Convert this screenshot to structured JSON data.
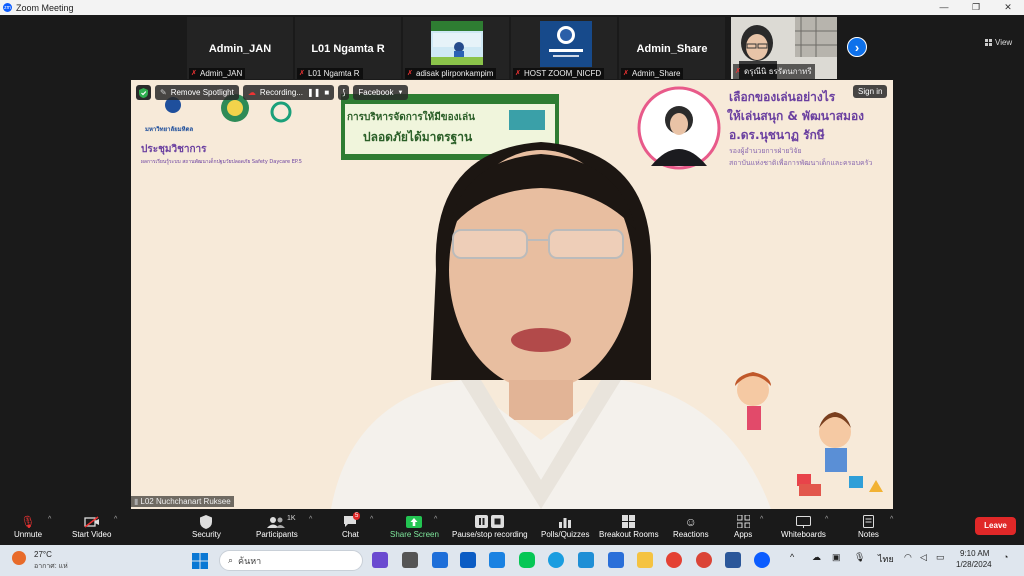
{
  "window": {
    "title": "Zoom Meeting",
    "icon": "zoom-logo-icon",
    "controls": [
      "minimize-icon",
      "maximize-icon",
      "close-icon"
    ]
  },
  "gallery": {
    "tiles": [
      {
        "name": "Admin_JAN",
        "label": "Admin_JAN",
        "video": false
      },
      {
        "name": "L01 Ngamta R",
        "label": "L01 Ngamta R",
        "video": false
      },
      {
        "name": "",
        "label": "adisak plirponkampim",
        "video": true
      },
      {
        "name": "",
        "label": "HOST ZOOM_NICFD",
        "video": true
      },
      {
        "name": "Admin_Share",
        "label": "Admin_Share",
        "video": false
      },
      {
        "name": "",
        "label": "ดรุณีนิ ธรรัตนกาทรี",
        "video": true
      }
    ],
    "next_icon": "chevron-right-icon",
    "view_label": "View"
  },
  "main_video": {
    "speaker_label": "L02 Nuchchanart Ruksee",
    "top_controls": {
      "remove_spotlight": "Remove Spotlight",
      "recording": "Recording...",
      "facebook": "Facebook"
    },
    "sign_in": "Sign in",
    "slide": {
      "university_name": "มหาวิทยาลัยมหิดล",
      "conference_label": "ประชุมวิชาการ",
      "subtitle": "ผลการเรียนรู้ระบบ สถานพัฒนาเด็กปฐมวัยปลอดภัย Safety Daycare EP.5",
      "banner_line1": "การบริหารจัดการให้มีของเล่น",
      "banner_line2": "ปลอดภัยได้มาตรฐาน",
      "headline_line1": "เลือกของเล่นอย่างไร",
      "headline_line2": "ให้เล่นสนุก & พัฒนาสมอง",
      "presenter_name": "อ.ดร.นุชนาฏ รักษี",
      "presenter_role": "รองผู้อำนวยการฝ่ายวิจัย",
      "presenter_org": "สถาบันแห่งชาติเพื่อการพัฒนาเด็กและครอบครัว"
    }
  },
  "toolbar": {
    "unmute": "Unmute",
    "start_video": "Start Video",
    "security": "Security",
    "participants": "Participants",
    "participants_count": "1K",
    "chat": "Chat",
    "chat_badge": "5",
    "share_screen": "Share Screen",
    "pause_recording": "Pause/stop recording",
    "polls": "Polls/Quizzes",
    "breakout": "Breakout Rooms",
    "reactions": "Reactions",
    "apps": "Apps",
    "whiteboards": "Whiteboards",
    "notes": "Notes",
    "leave": "Leave"
  },
  "taskbar": {
    "weather_temp": "27°C",
    "weather_desc": "อากาศ: แห่",
    "search_placeholder": "ค้นหา",
    "language": "ไทย",
    "time": "9:10 AM",
    "date": "1/28/2024"
  },
  "colors": {
    "zoom_blue": "#0e71eb",
    "leave_red": "#e02828",
    "slide_bg": "#f6e8d6",
    "slide_purple": "#6a3fa0"
  }
}
